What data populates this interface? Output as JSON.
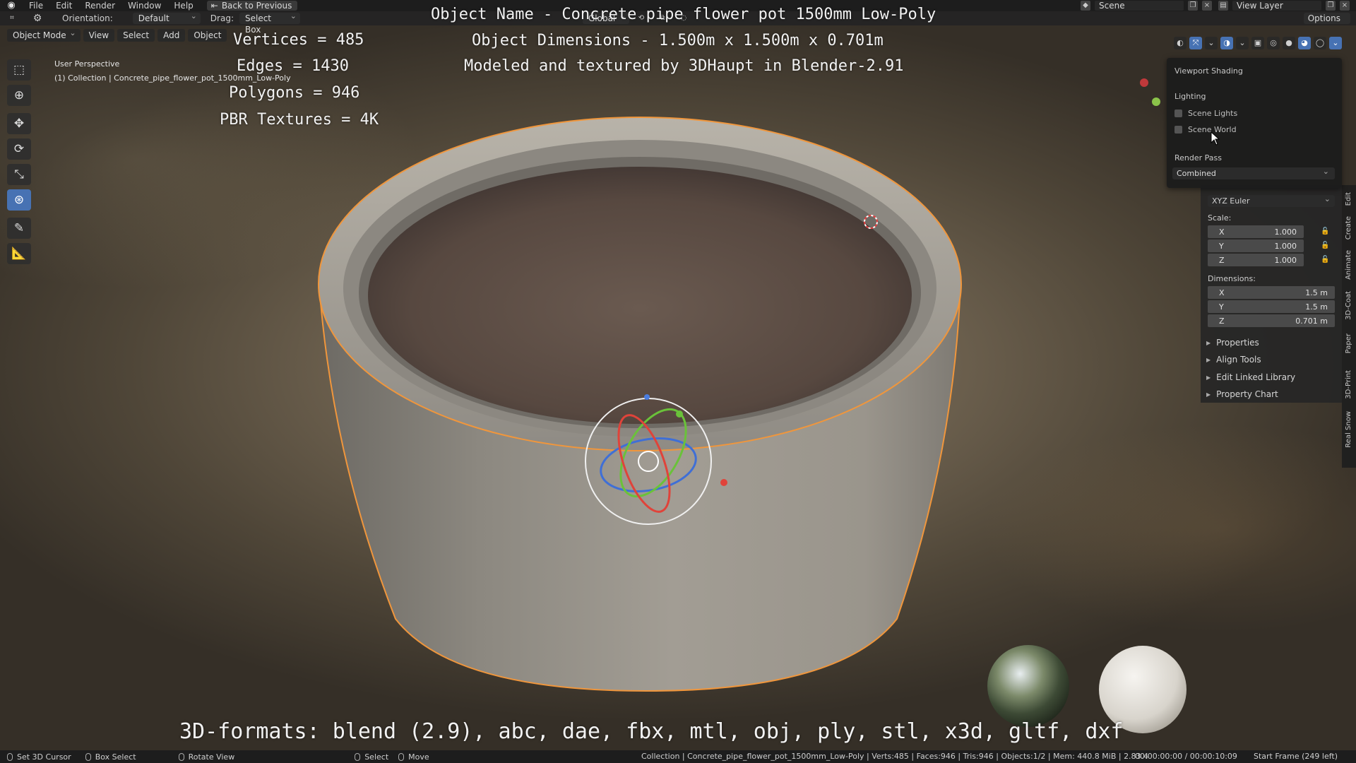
{
  "menu": {
    "items": [
      "File",
      "Edit",
      "Render",
      "Window",
      "Help"
    ],
    "back_label": "Back to Previous",
    "scene": "Scene",
    "view_layer": "View Layer"
  },
  "tool_settings": {
    "orientation_label": "Orientation:",
    "orientation_value": "Default",
    "drag_label": "Drag:",
    "drag_value": "Select Box",
    "transform_orientation": "Global",
    "options_label": "Options"
  },
  "viewport_header": {
    "mode": "Object Mode",
    "view": "View",
    "select": "Select",
    "add": "Add",
    "object": "Object"
  },
  "viewport": {
    "perspective": "User Perspective",
    "collection": "(1) Collection | Concrete_pipe_flower_pot_1500mm_Low-Poly"
  },
  "overlay": {
    "object_name": "Object Name - Concrete pipe flower pot 1500mm Low-Poly",
    "object_dimensions": "Object Dimensions -  1.500m x 1.500m x 0.701m",
    "modeled_by": "Modeled and textured by 3DHaupt in Blender-2.91",
    "vertices": "Vertices = 485",
    "edges": "Edges = 1430",
    "polygons": "Polygons = 946",
    "pbr": "PBR Textures = 4K",
    "formats": "3D-formats: blend (2.9), abc, dae, fbx, mtl, obj, ply, stl, x3d, gltf, dxf"
  },
  "shading_popover": {
    "title": "Viewport Shading",
    "lighting": "Lighting",
    "scene_lights": "Scene Lights",
    "scene_world": "Scene World",
    "render_pass_label": "Render Pass",
    "render_pass_value": "Combined"
  },
  "npanel": {
    "rotation_mode": "XYZ Euler",
    "scale_label": "Scale:",
    "scale": [
      {
        "axis": "X",
        "value": "1.000"
      },
      {
        "axis": "Y",
        "value": "1.000"
      },
      {
        "axis": "Z",
        "value": "1.000"
      }
    ],
    "dimensions_label": "Dimensions:",
    "dimensions": [
      {
        "axis": "X",
        "value": "1.5 m"
      },
      {
        "axis": "Y",
        "value": "1.5 m"
      },
      {
        "axis": "Z",
        "value": "0.701 m"
      }
    ],
    "sections": [
      "Properties",
      "Align Tools",
      "Edit Linked Library",
      "Property Chart"
    ],
    "tabs": [
      "Edit",
      "Create",
      "Animate",
      "3D-Coat",
      "Paper",
      "3D-Print",
      "Real Snow"
    ]
  },
  "statusbar": {
    "set_cursor": "Set 3D Cursor",
    "box_select": "Box Select",
    "rotate_view": "Rotate View",
    "select": "Select",
    "move": "Move",
    "info": "Collection | Concrete_pipe_flower_pot_1500mm_Low-Poly | Verts:485 | Faces:946 | Tris:946 | Objects:1/2 | Mem: 440.8 MiB | 2.83.4",
    "time": "00:00:00:00 / 00:00:10:09",
    "frame": "Start Frame (249 left)"
  },
  "colors": {
    "accent": "#4772b3",
    "selection_outline": "#f0963c",
    "concrete": "#9a958c",
    "soil": "#5b4a40"
  }
}
